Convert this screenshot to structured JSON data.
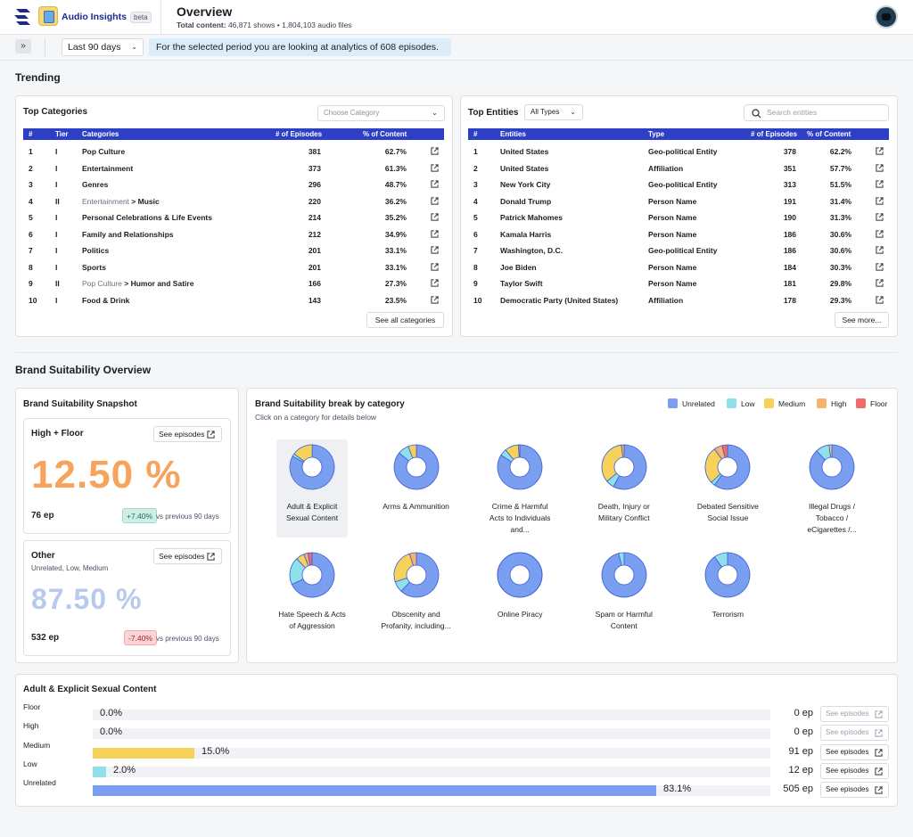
{
  "header": {
    "app_name": "Audio Insights",
    "beta": "beta",
    "title": "Overview",
    "total_label": "Total content:",
    "total_value": "46,871 shows • 1,804,103 audio files"
  },
  "filters": {
    "period": "Last 90 days",
    "info": "For the selected period you are looking at analytics of 608 episodes."
  },
  "trending": {
    "title": "Trending",
    "categories": {
      "title": "Top Categories",
      "select_placeholder": "Choose Category",
      "headers": [
        "#",
        "Tier",
        "Categories",
        "# of Episodes",
        "% of Content"
      ],
      "rows": [
        {
          "n": "1",
          "tier": "I",
          "parent": "",
          "name": "Pop Culture",
          "eps": "381",
          "pct": "62.7%"
        },
        {
          "n": "2",
          "tier": "I",
          "parent": "",
          "name": "Entertainment",
          "eps": "373",
          "pct": "61.3%"
        },
        {
          "n": "3",
          "tier": "I",
          "parent": "",
          "name": "Genres",
          "eps": "296",
          "pct": "48.7%"
        },
        {
          "n": "4",
          "tier": "II",
          "parent": "Entertainment",
          "name": "Music",
          "eps": "220",
          "pct": "36.2%"
        },
        {
          "n": "5",
          "tier": "I",
          "parent": "",
          "name": "Personal Celebrations & Life Events",
          "eps": "214",
          "pct": "35.2%"
        },
        {
          "n": "6",
          "tier": "I",
          "parent": "",
          "name": "Family and Relationships",
          "eps": "212",
          "pct": "34.9%"
        },
        {
          "n": "7",
          "tier": "I",
          "parent": "",
          "name": "Politics",
          "eps": "201",
          "pct": "33.1%"
        },
        {
          "n": "8",
          "tier": "I",
          "parent": "",
          "name": "Sports",
          "eps": "201",
          "pct": "33.1%"
        },
        {
          "n": "9",
          "tier": "II",
          "parent": "Pop Culture",
          "name": "Humor and Satire",
          "eps": "166",
          "pct": "27.3%"
        },
        {
          "n": "10",
          "tier": "I",
          "parent": "",
          "name": "Food & Drink",
          "eps": "143",
          "pct": "23.5%"
        }
      ],
      "see_all": "See all categories"
    },
    "entities": {
      "title": "Top Entities",
      "type_select": "All Types",
      "search_placeholder": "Search entities",
      "headers": [
        "#",
        "Entities",
        "Type",
        "# of Episodes",
        "% of Content"
      ],
      "rows": [
        {
          "n": "1",
          "name": "United States",
          "type": "Geo-political Entity",
          "eps": "378",
          "pct": "62.2%"
        },
        {
          "n": "2",
          "name": "United States",
          "type": "Affiliation",
          "eps": "351",
          "pct": "57.7%"
        },
        {
          "n": "3",
          "name": "New York City",
          "type": "Geo-political Entity",
          "eps": "313",
          "pct": "51.5%"
        },
        {
          "n": "4",
          "name": "Donald Trump",
          "type": "Person Name",
          "eps": "191",
          "pct": "31.4%"
        },
        {
          "n": "5",
          "name": "Patrick Mahomes",
          "type": "Person Name",
          "eps": "190",
          "pct": "31.3%"
        },
        {
          "n": "6",
          "name": "Kamala Harris",
          "type": "Person Name",
          "eps": "186",
          "pct": "30.6%"
        },
        {
          "n": "7",
          "name": "Washington, D.C.",
          "type": "Geo-political Entity",
          "eps": "186",
          "pct": "30.6%"
        },
        {
          "n": "8",
          "name": "Joe Biden",
          "type": "Person Name",
          "eps": "184",
          "pct": "30.3%"
        },
        {
          "n": "9",
          "name": "Taylor Swift",
          "type": "Person Name",
          "eps": "181",
          "pct": "29.8%"
        },
        {
          "n": "10",
          "name": "Democratic Party (United States)",
          "type": "Affiliation",
          "eps": "178",
          "pct": "29.3%"
        }
      ],
      "see_more": "See more..."
    }
  },
  "brand": {
    "title": "Brand Suitability Overview",
    "snapshot": {
      "title": "Brand Suitability Snapshot",
      "high": {
        "title": "High + Floor",
        "button": "See episodes",
        "pct": "12.50 %",
        "eps": "76 ep",
        "delta": "+7.40%",
        "vs": "vs previous 90 days"
      },
      "other": {
        "title": "Other",
        "subtitle": "Unrelated, Low, Medium",
        "button": "See episodes",
        "pct": "87.50 %",
        "eps": "532 ep",
        "delta": "-7.40%",
        "vs": "vs previous 90 days"
      }
    },
    "breakdown": {
      "title": "Brand Suitability break by category",
      "subtitle": "Click on a category for details below",
      "legend": [
        {
          "label": "Unrelated",
          "color": "#7a9ff0"
        },
        {
          "label": "Low",
          "color": "#8fe0ea"
        },
        {
          "label": "Medium",
          "color": "#f7d25a"
        },
        {
          "label": "High",
          "color": "#f7b26b"
        },
        {
          "label": "Floor",
          "color": "#f06c6c"
        }
      ],
      "categories": [
        {
          "label": "Adult & Explicit Sexual Content",
          "shares": [
            0.831,
            0.02,
            0.15,
            0,
            0
          ]
        },
        {
          "label": "Arms & Ammunition",
          "shares": [
            0.86,
            0.08,
            0.06,
            0,
            0
          ]
        },
        {
          "label": "Crime & Harmful Acts to Individuals and...",
          "shares": [
            0.84,
            0.05,
            0.1,
            0.01,
            0
          ]
        },
        {
          "label": "Death, Injury or Military Conflict",
          "shares": [
            0.58,
            0.06,
            0.34,
            0.02,
            0
          ]
        },
        {
          "label": "Debated Sensitive Social Issue",
          "shares": [
            0.6,
            0.03,
            0.27,
            0.06,
            0.04
          ]
        },
        {
          "label": "Illegal Drugs / Tobacco / eCigarettes /...",
          "shares": [
            0.88,
            0.1,
            0.02,
            0,
            0
          ]
        },
        {
          "label": "Hate Speech & Acts of Aggression",
          "shares": [
            0.68,
            0.2,
            0.06,
            0.03,
            0.03
          ]
        },
        {
          "label": "Obscenity and Profanity, including...",
          "shares": [
            0.62,
            0.08,
            0.25,
            0.05,
            0
          ]
        },
        {
          "label": "Online Piracy",
          "shares": [
            1,
            0,
            0,
            0,
            0
          ]
        },
        {
          "label": "Spam or Harmful Content",
          "shares": [
            0.96,
            0.04,
            0,
            0,
            0
          ]
        },
        {
          "label": "Terrorism",
          "shares": [
            0.9,
            0.1,
            0,
            0,
            0
          ]
        }
      ]
    },
    "detail": {
      "title": "Adult & Explicit Sexual Content",
      "rows": [
        {
          "label": "Floor",
          "pct": "0.0%",
          "share": 0,
          "eps": "0 ep",
          "color": "#f06c6c",
          "button": "See episodes",
          "enabled": false
        },
        {
          "label": "High",
          "pct": "0.0%",
          "share": 0,
          "eps": "0 ep",
          "color": "#f7b26b",
          "button": "See episodes",
          "enabled": false
        },
        {
          "label": "Medium",
          "pct": "15.0%",
          "share": 0.15,
          "eps": "91 ep",
          "color": "#f7d25a",
          "button": "See episodes",
          "enabled": true
        },
        {
          "label": "Low",
          "pct": "2.0%",
          "share": 0.02,
          "eps": "12 ep",
          "color": "#8fe0ea",
          "button": "See episodes",
          "enabled": true
        },
        {
          "label": "Unrelated",
          "pct": "83.1%",
          "share": 0.831,
          "eps": "505 ep",
          "color": "#7a9ff0",
          "button": "See episodes",
          "enabled": true
        }
      ]
    }
  }
}
